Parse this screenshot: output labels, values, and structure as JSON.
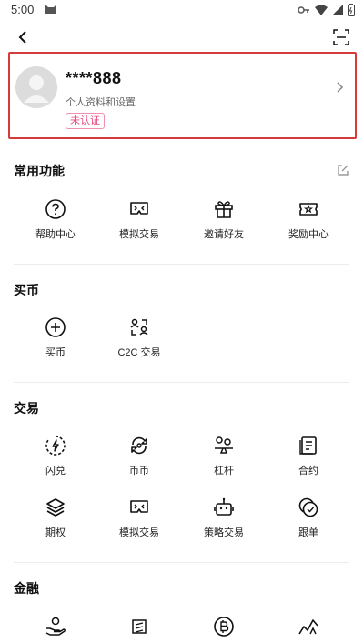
{
  "status_bar": {
    "time": "5:00"
  },
  "profile": {
    "username": "****888",
    "subtitle": "个人资料和设置",
    "badge": "未认证"
  },
  "sections": {
    "common": {
      "title": "常用功能",
      "items": [
        {
          "label": "帮助中心",
          "icon": "help-icon"
        },
        {
          "label": "模拟交易",
          "icon": "vr-icon"
        },
        {
          "label": "邀请好友",
          "icon": "gift-icon"
        },
        {
          "label": "奖励中心",
          "icon": "ticket-icon"
        }
      ]
    },
    "buy": {
      "title": "买币",
      "items": [
        {
          "label": "买币",
          "icon": "plus-circle-icon"
        },
        {
          "label": "C2C 交易",
          "icon": "c2c-icon"
        }
      ]
    },
    "trade": {
      "title": "交易",
      "items": [
        {
          "label": "闪兑",
          "icon": "flash-icon"
        },
        {
          "label": "币币",
          "icon": "swap-icon"
        },
        {
          "label": "杠杆",
          "icon": "leverage-icon"
        },
        {
          "label": "合约",
          "icon": "contract-icon"
        },
        {
          "label": "期权",
          "icon": "layers-icon"
        },
        {
          "label": "模拟交易",
          "icon": "vr-icon"
        },
        {
          "label": "策略交易",
          "icon": "robot-icon"
        },
        {
          "label": "跟单",
          "icon": "copy-trade-icon"
        }
      ]
    },
    "finance": {
      "title": "金融",
      "items": [
        {
          "label": "",
          "icon": "hand-coin-icon"
        },
        {
          "label": "",
          "icon": "earn-icon"
        },
        {
          "label": "",
          "icon": "bitcoin-icon"
        },
        {
          "label": "",
          "icon": "chart-icon"
        }
      ]
    }
  },
  "colors": {
    "highlight_border": "#d43c3c",
    "badge": "#e8457a"
  }
}
